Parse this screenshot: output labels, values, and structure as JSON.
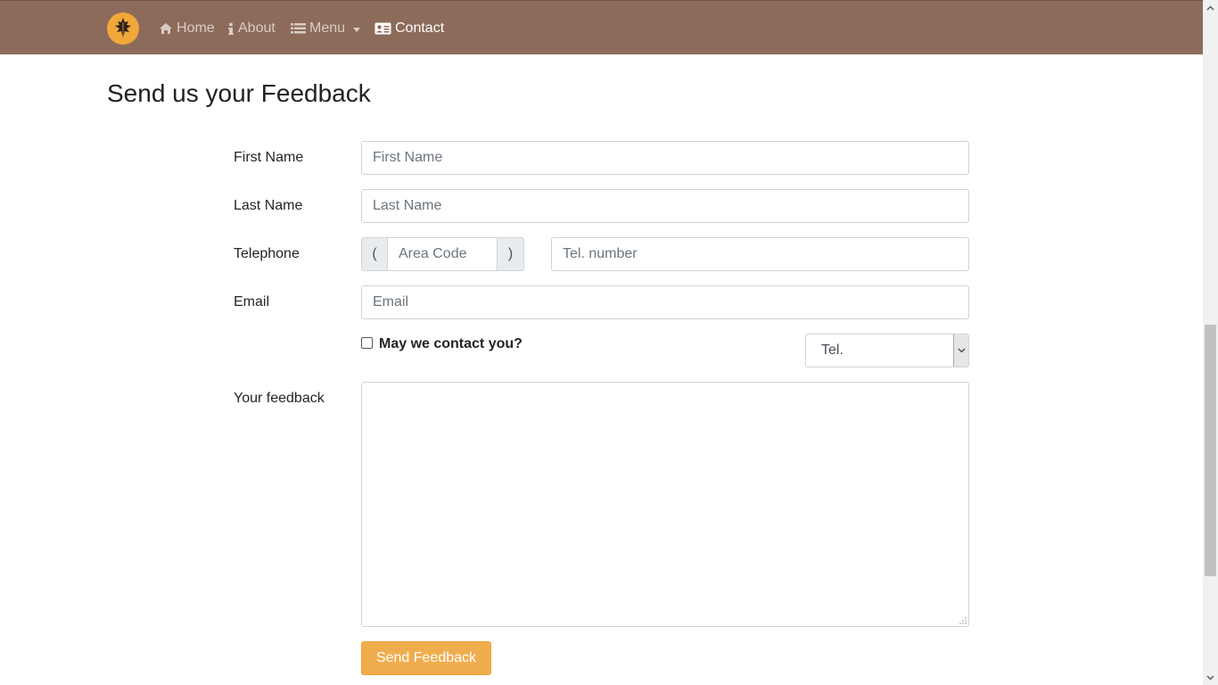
{
  "nav": {
    "items": [
      {
        "label": "Home",
        "icon": "home-icon"
      },
      {
        "label": "About",
        "icon": "info-icon"
      },
      {
        "label": "Menu",
        "icon": "list-icon"
      },
      {
        "label": "Contact",
        "icon": "address-card-icon"
      }
    ],
    "active": "Contact",
    "brand_color": "#8d6b5b",
    "logo_color": "#f0a83a"
  },
  "page": {
    "title": "Send us your Feedback"
  },
  "form": {
    "first_name": {
      "label": "First Name",
      "placeholder": "First Name"
    },
    "last_name": {
      "label": "Last Name",
      "placeholder": "Last Name"
    },
    "telephone": {
      "label": "Telephone",
      "area_prefix": "(",
      "area_placeholder": "Area Code",
      "area_suffix": ")",
      "number_placeholder": "Tel. number"
    },
    "email": {
      "label": "Email",
      "placeholder": "Email"
    },
    "contact_checkbox": {
      "label": "May we contact you?",
      "checked": false
    },
    "contact_method": {
      "selected": "Tel."
    },
    "feedback": {
      "label": "Your feedback",
      "value": ""
    },
    "submit_label": "Send Feedback",
    "submit_color": "#f0ad4e"
  }
}
